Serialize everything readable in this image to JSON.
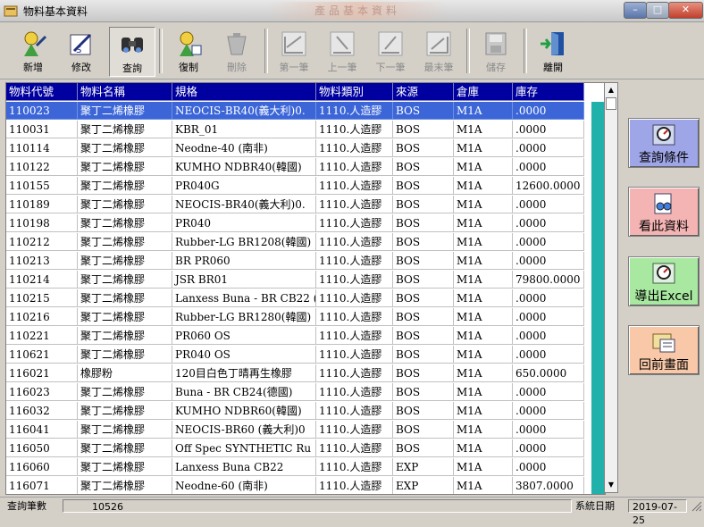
{
  "window": {
    "title": "物料基本資料",
    "banner": "產品基本資料",
    "minimize": "–",
    "maximize": "□",
    "close": "✕"
  },
  "toolbar": {
    "add": "新增",
    "edit": "修改",
    "query": "查詢",
    "copy": "復制",
    "delete": "刪除",
    "first": "第一筆",
    "prev": "上一筆",
    "next": "下一筆",
    "last": "最末筆",
    "save": "儲存",
    "exit": "離開"
  },
  "grid": {
    "columns": [
      "物料代號",
      "物料名稱",
      "規格",
      "物料類別",
      "來源",
      "倉庫",
      "庫存"
    ],
    "selected_row": 0,
    "rows": [
      [
        "110023",
        "聚丁二烯橡膠",
        "NEOCIS-BR40(義大利)0.",
        "1110.人造膠",
        "BOS",
        "M1A",
        ".0000"
      ],
      [
        "110031",
        "聚丁二烯橡膠",
        "KBR_01",
        "1110.人造膠",
        "BOS",
        "M1A",
        ".0000"
      ],
      [
        "110114",
        "聚丁二烯橡膠",
        "Neodne-40 (南非)",
        "1110.人造膠",
        "BOS",
        "M1A",
        ".0000"
      ],
      [
        "110122",
        "聚丁二烯橡膠",
        "KUMHO NDBR40(韓國)",
        "1110.人造膠",
        "BOS",
        "M1A",
        ".0000"
      ],
      [
        "110155",
        "聚丁二烯橡膠",
        "PR040G",
        "1110.人造膠",
        "BOS",
        "M1A",
        "12600.0000"
      ],
      [
        "110189",
        "聚丁二烯橡膠",
        "NEOCIS-BR40(義大利)0.",
        "1110.人造膠",
        "BOS",
        "M1A",
        ".0000"
      ],
      [
        "110198",
        "聚丁二烯橡膠",
        "PR040",
        "1110.人造膠",
        "BOS",
        "M1A",
        ".0000"
      ],
      [
        "110212",
        "聚丁二烯橡膠",
        "Rubber-LG BR1208(韓國)",
        "1110.人造膠",
        "BOS",
        "M1A",
        ".0000"
      ],
      [
        "110213",
        "聚丁二烯橡膠",
        "BR PR060",
        "1110.人造膠",
        "BOS",
        "M1A",
        ".0000"
      ],
      [
        "110214",
        "聚丁二烯橡膠",
        "JSR BR01",
        "1110.人造膠",
        "BOS",
        "M1A",
        "79800.0000"
      ],
      [
        "110215",
        "聚丁二烯橡膠",
        "Lanxess Buna - BR CB22 (",
        "1110.人造膠",
        "BOS",
        "M1A",
        ".0000"
      ],
      [
        "110216",
        "聚丁二烯橡膠",
        "Rubber-LG BR1280(韓國)",
        "1110.人造膠",
        "BOS",
        "M1A",
        ".0000"
      ],
      [
        "110221",
        "聚丁二烯橡膠",
        "PR060 OS",
        "1110.人造膠",
        "BOS",
        "M1A",
        ".0000"
      ],
      [
        "110621",
        "聚丁二烯橡膠",
        "PR040 OS",
        "1110.人造膠",
        "BOS",
        "M1A",
        ".0000"
      ],
      [
        "116021",
        "橡膠粉",
        "120目白色丁晴再生橡膠",
        "1110.人造膠",
        "BOS",
        "M1A",
        "650.0000"
      ],
      [
        "116023",
        "聚丁二烯橡膠",
        "Buna - BR CB24(德國)",
        "1110.人造膠",
        "BOS",
        "M1A",
        ".0000"
      ],
      [
        "116032",
        "聚丁二烯橡膠",
        "KUMHO NDBR60(韓國)",
        "1110.人造膠",
        "BOS",
        "M1A",
        ".0000"
      ],
      [
        "116041",
        "聚丁二烯橡膠",
        "NEOCIS-BR60 (義大利)0",
        "1110.人造膠",
        "BOS",
        "M1A",
        ".0000"
      ],
      [
        "116050",
        "聚丁二烯橡膠",
        "Off Spec SYNTHETIC Ru",
        "1110.人造膠",
        "BOS",
        "M1A",
        ".0000"
      ],
      [
        "116060",
        "聚丁二烯橡膠",
        "Lanxess Buna CB22",
        "1110.人造膠",
        "EXP",
        "M1A",
        ".0000"
      ],
      [
        "116071",
        "聚丁二烯橡膠",
        "Neodne-60 (南非)",
        "1110.人造膠",
        "EXP",
        "M1A",
        "3807.0000"
      ]
    ]
  },
  "side": {
    "query_cond": "查詢條件",
    "view": "看此資料",
    "export": "導出Excel",
    "back": "回前畫面"
  },
  "status": {
    "count_label": "查詢筆數",
    "count_value": "10526",
    "date_label": "系統日期",
    "date_value": "2019-07-25"
  },
  "scroll": {
    "up": "▲",
    "down": "▼"
  },
  "colors": {
    "header_bg": "#0000a0",
    "selected_bg": "#3c66d8",
    "accent_teal": "#20b2aa",
    "side_query": "#9fa6e8",
    "side_view": "#f4b4b4",
    "side_export": "#a8e8a0",
    "side_back": "#f8c8a8"
  }
}
